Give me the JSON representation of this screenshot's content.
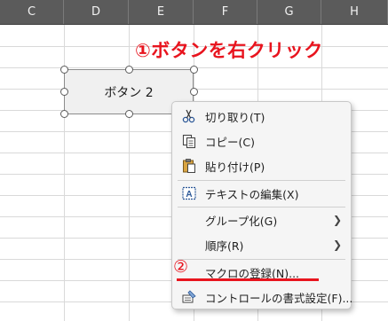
{
  "columns": [
    "C",
    "D",
    "E",
    "F",
    "G",
    "H"
  ],
  "annotation_top": "①ボタンを右クリック",
  "shape_label": "ボタン 2",
  "annotation_step2": "②",
  "menu": {
    "cut": "切り取り(T)",
    "copy": "コピー(C)",
    "paste": "貼り付け(P)",
    "edit_text": "テキストの編集(X)",
    "group": "グループ化(G)",
    "order": "順序(R)",
    "assign_macro": "マクロの登録(N)...",
    "format_control": "コントロールの書式設定(F)..."
  },
  "colors": {
    "accent": "#e8141e",
    "header_bg": "#5b5b5b",
    "menu_bg": "#f5f5f5"
  }
}
